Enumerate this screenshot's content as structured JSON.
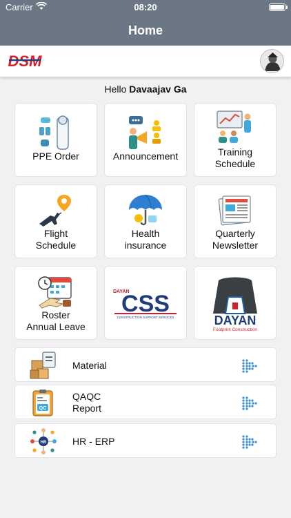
{
  "status": {
    "carrier": "Carrier",
    "time": "08:20"
  },
  "header": {
    "title": "Home"
  },
  "brand": {
    "logo_text": "DSM"
  },
  "greeting": {
    "prefix": "Hello ",
    "name": "Davaajav Ga"
  },
  "tiles": [
    {
      "label": "PPE Order",
      "icon": "ppe-suit-icon"
    },
    {
      "label": "Announcement",
      "icon": "megaphone-icon"
    },
    {
      "label": "Training\nSchedule",
      "icon": "training-presentation-icon"
    },
    {
      "label": "Flight\nSchedule",
      "icon": "airplane-route-icon"
    },
    {
      "label": "Health\ninsurance",
      "icon": "umbrella-icon"
    },
    {
      "label": "Quarterly\nNewsletter",
      "icon": "newspaper-icon"
    },
    {
      "label": "Roster\nAnnual Leave",
      "icon": "calendar-plane-icon"
    },
    {
      "label": "",
      "icon": "css-logo",
      "logo_text": "CSS",
      "logo_sub": "CONSTRUCTION SUPPORT SERVICES",
      "logo_badge": "DAYAN"
    },
    {
      "label": "",
      "icon": "dayan-logo",
      "logo_text": "DAYAN",
      "logo_sub": "Footprint  Construction"
    }
  ],
  "list": [
    {
      "label": "Material",
      "icon": "boxes-clipboard-icon"
    },
    {
      "label": "QAQC\nReport",
      "icon": "qc-clipboard-icon"
    },
    {
      "label": "HR - ERP",
      "icon": "hr-network-icon"
    }
  ],
  "colors": {
    "header": "#6b7785",
    "brand_red": "#d1202b",
    "css_navy": "#1f3b7a",
    "chevron": "#3a8fd6"
  }
}
